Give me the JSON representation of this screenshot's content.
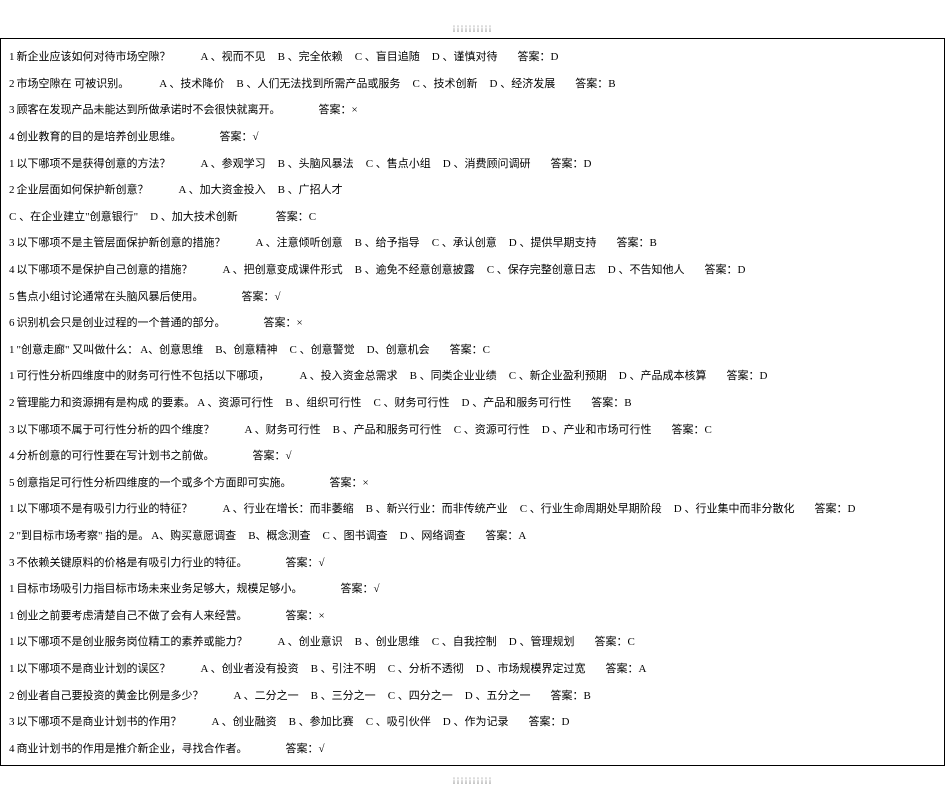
{
  "marker_top": "¡¡¡¡¡¡¡¡¡¡",
  "marker_bottom": "¡¡¡¡¡¡¡¡¡¡",
  "answer_label": "答案：",
  "lines": [
    {
      "type": "mc",
      "num": "1",
      "q": "新企业应该如何对待市场空隙？",
      "opts": [
        "A 、视而不见",
        "B 、完全依赖",
        "C 、盲目追随",
        "D 、谨慎对待"
      ],
      "ans": "D"
    },
    {
      "type": "mc",
      "num": "2",
      "q": "市场空隙在   可被识别。",
      "opts": [
        "A 、技术降价",
        "B 、人们无法找到所需产品或服务",
        "C 、技术创新",
        "D 、经济发展"
      ],
      "ans": "B"
    },
    {
      "type": "tf",
      "num": "3",
      "q": "顾客在发现产品未能达到所做承诺时不会很快就离开。",
      "ans": "×"
    },
    {
      "type": "tf",
      "num": "4",
      "q": "创业教育的目的是培养创业思维。",
      "ans": "√"
    },
    {
      "type": "mc",
      "num": "1",
      "q": "以下哪项不是获得创意的方法？",
      "opts": [
        "A 、参观学习",
        "B 、头脑风暴法",
        "C 、售点小组",
        "D 、消费顾问调研"
      ],
      "ans": "D"
    },
    {
      "type": "mc2",
      "num": "2",
      "line1_q": "企业层面如何保护新创意？",
      "line1_opts": [
        "A 、加大资金投入",
        "B 、广招人才"
      ],
      "line2_opts": [
        "C 、在企业建立\"创意银行\"",
        "D 、加大技术创新"
      ],
      "line2_ans": "C"
    },
    {
      "type": "mc",
      "num": "3",
      "q": "以下哪项不是主管层面保护新创意的措施？",
      "opts": [
        "A 、注意倾听创意",
        "B 、给予指导",
        "C 、承认创意",
        "D 、提供早期支持"
      ],
      "ans": "B"
    },
    {
      "type": "mc",
      "num": "4",
      "q": "以下哪项不是保护自己创意的措施？",
      "opts": [
        "A 、把创意变成课件形式",
        "B 、逾免不经意创意披露",
        "C 、保存完整创意日志",
        "D 、不告知他人"
      ],
      "ans": "D"
    },
    {
      "type": "tf",
      "num": "5",
      "q": "售点小组讨论通常在头脑风暴后使用。",
      "ans": "√"
    },
    {
      "type": "tf",
      "num": "6",
      "q": "识别机会只是创业过程的一个普通的部分。",
      "ans": "×"
    },
    {
      "type": "mc",
      "num": "1",
      "q": "\"创意走廊\" 又叫做什么：",
      "opts_inline": true,
      "opts": [
        "A、创意思维",
        "B、创意精神",
        "C 、创意警觉",
        "D、创意机会"
      ],
      "ans": "C"
    },
    {
      "type": "mc",
      "num": "1",
      "q": "可行性分析四维度中的财务可行性不包括以下哪项，",
      "opts": [
        "A 、投入资金总需求",
        "B 、同类企业业绩",
        "C 、新企业盈利预期",
        "D 、产品成本核算"
      ],
      "ans": "D"
    },
    {
      "type": "mc",
      "num": "2",
      "q": "管理能力和资源拥有是构成   的要素。",
      "opts_inline": true,
      "opts": [
        "A 、资源可行性",
        "B 、组织可行性",
        "C 、财务可行性",
        "D 、产品和服务可行性"
      ],
      "ans": "B"
    },
    {
      "type": "mc",
      "num": "3",
      "q": "以下哪项不属于可行性分析的四个维度？",
      "opts": [
        "A 、财务可行性",
        "B 、产品和服务可行性",
        "C 、资源可行性",
        "D 、产业和市场可行性"
      ],
      "ans": "C"
    },
    {
      "type": "tf",
      "num": "4",
      "q": "分析创意的可行性要在写计划书之前做。",
      "ans": "√"
    },
    {
      "type": "tf",
      "num": "5",
      "q": "创意指足可行性分析四维度的一个或多个方面即可实施。",
      "ans": "×"
    },
    {
      "type": "mc",
      "num": "1",
      "q": "以下哪项不是有吸引力行业的特征？",
      "opts": [
        "A 、行业在增长：而非萎缩",
        "B 、新兴行业：而非传统产业",
        "C 、行业生命周期处早期阶段",
        "D 、行业集中而非分散化"
      ],
      "ans": "D"
    },
    {
      "type": "mc",
      "num": "2",
      "q": "\"到目标市场考察\" 指的是。",
      "opts_inline": true,
      "opts": [
        "A、购买意愿调查",
        "B、概念测查",
        "C 、图书调查",
        "D 、网络调查"
      ],
      "ans": "A"
    },
    {
      "type": "tf",
      "num": "3",
      "q": "不依赖关键原料的价格是有吸引力行业的特征。",
      "ans": "√"
    },
    {
      "type": "tf",
      "num": "1",
      "q": "目标市场吸引力指目标市场未来业务足够大，规模足够小。",
      "ans": "√"
    },
    {
      "type": "tf",
      "num": "1",
      "q": "创业之前要考虑清楚自己不做了会有人来经营。",
      "ans": "×"
    },
    {
      "type": "mc",
      "num": "1",
      "q": "以下哪项不是创业服务岗位精工的素养或能力？",
      "opts": [
        "A 、创业意识",
        "B 、创业思维",
        "C 、自我控制",
        "D 、管理规划"
      ],
      "ans": "C"
    },
    {
      "type": "mc",
      "num": "1",
      "q": "以下哪项不是商业计划的误区？",
      "opts": [
        "A 、创业者没有投资",
        "B 、引注不明",
        "C 、分析不透彻",
        "D 、市场规模界定过宽"
      ],
      "ans": "A"
    },
    {
      "type": "mc",
      "num": "2",
      "q": "创业者自己要投资的黄金比例是多少？",
      "opts": [
        "A 、二分之一",
        "B 、三分之一",
        "C 、四分之一",
        "D 、五分之一"
      ],
      "ans": "B"
    },
    {
      "type": "mc",
      "num": "3",
      "q": "以下哪项不是商业计划书的作用？",
      "opts": [
        "A 、创业融资",
        "B 、参加比赛",
        "C 、吸引伙伴",
        "D 、作为记录"
      ],
      "ans": "D"
    },
    {
      "type": "tf",
      "num": "4",
      "q": "商业计划书的作用是推介新企业，寻找合作者。",
      "ans": "√"
    }
  ]
}
